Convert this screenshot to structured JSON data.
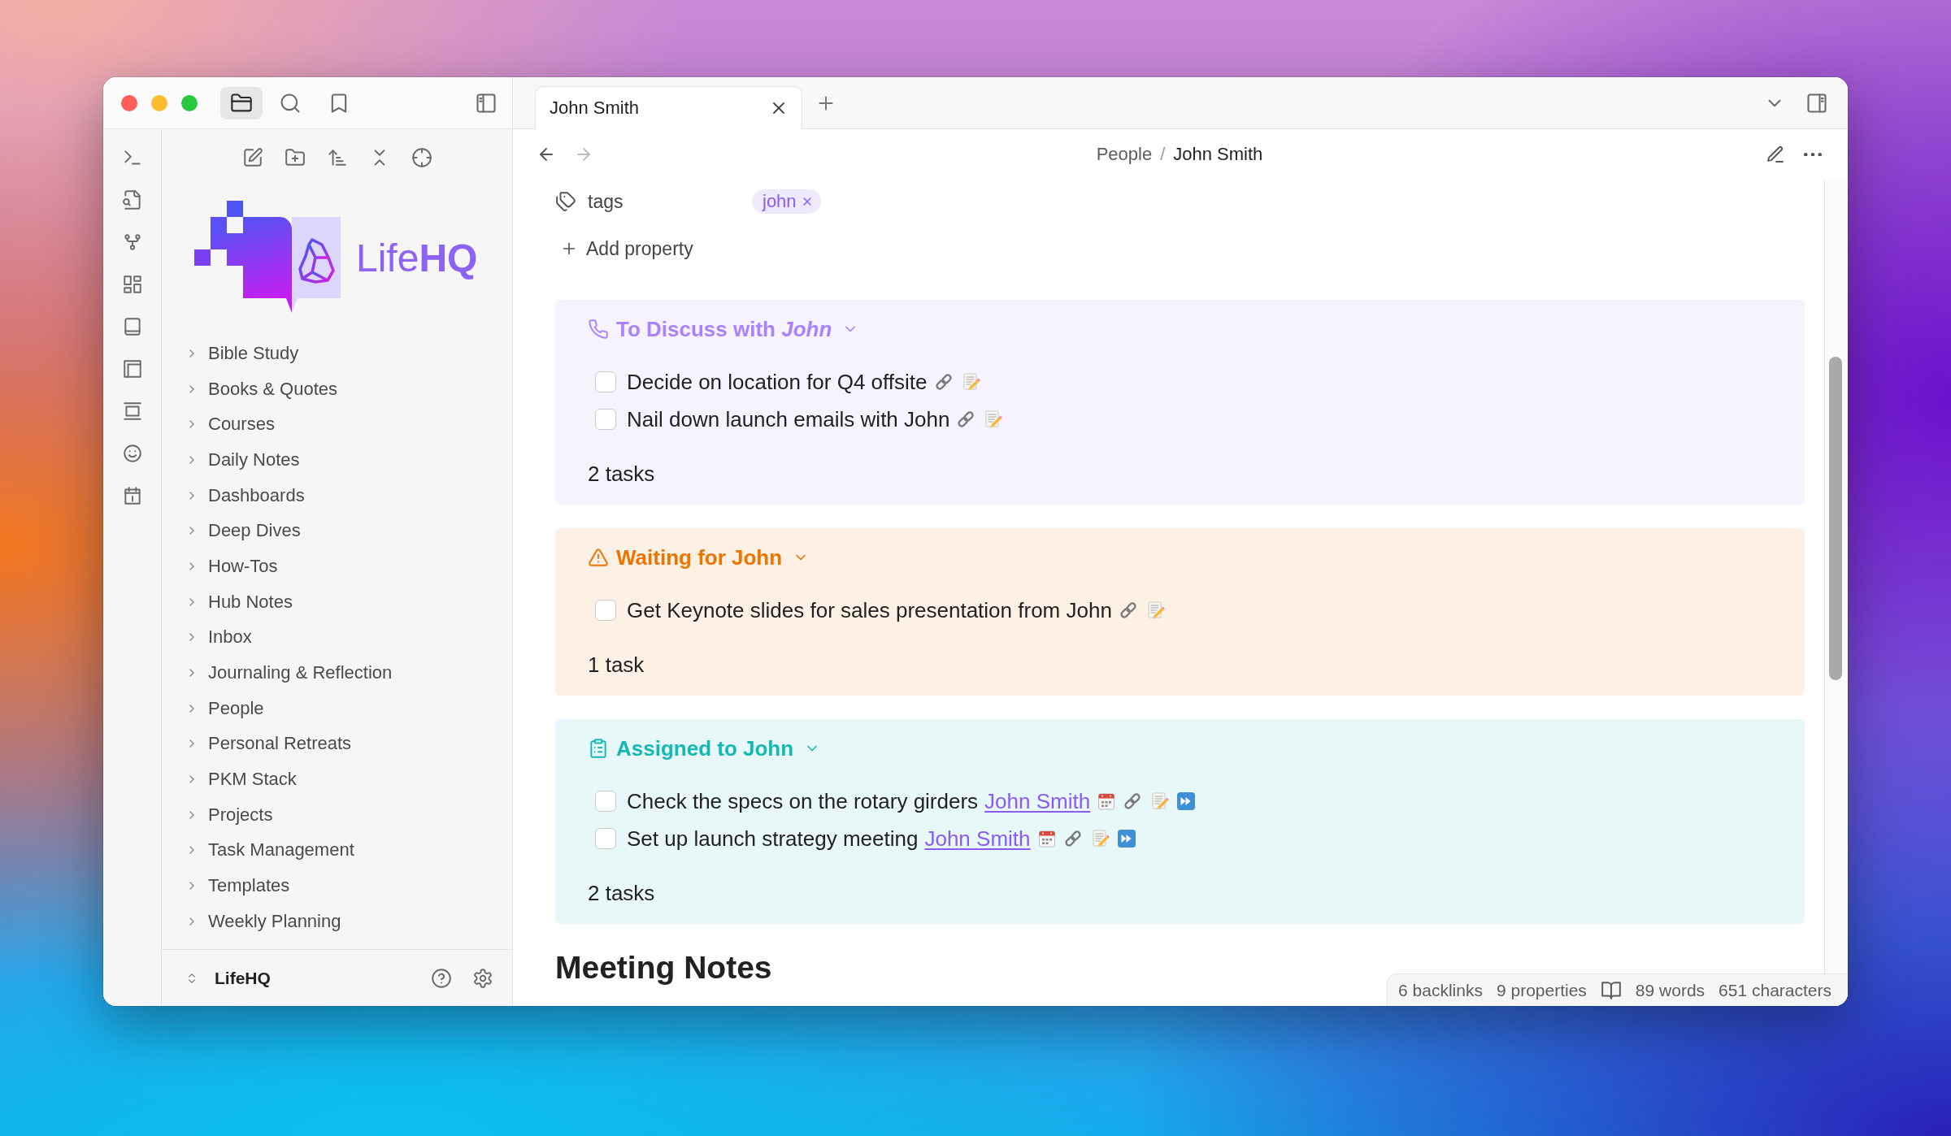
{
  "sidebar_tabs": [
    {
      "kind": "files",
      "selected": true
    },
    {
      "kind": "search",
      "selected": false
    },
    {
      "kind": "bookmarks",
      "selected": false
    }
  ],
  "logo": {
    "text": "Life**HQ**"
  },
  "folders": [
    {
      "name": "Bible Study",
      "expanded": false
    },
    {
      "name": "Books & Quotes",
      "expanded": false
    },
    {
      "name": "Courses",
      "expanded": false
    },
    {
      "name": "Daily Notes",
      "expanded": false
    },
    {
      "name": "Dashboards",
      "expanded": false
    },
    {
      "name": "Deep Dives",
      "expanded": false
    },
    {
      "name": "How-Tos",
      "expanded": false
    },
    {
      "name": "Hub Notes",
      "expanded": false
    },
    {
      "name": "Inbox",
      "expanded": false
    },
    {
      "name": "Journaling & Reflection",
      "expanded": false
    },
    {
      "name": "People",
      "expanded": false
    },
    {
      "name": "Personal Retreats",
      "expanded": false
    },
    {
      "name": "PKM Stack",
      "expanded": false
    },
    {
      "name": "Projects",
      "expanded": false
    },
    {
      "name": "Task Management",
      "expanded": false
    },
    {
      "name": "Templates",
      "expanded": false
    },
    {
      "name": "Weekly Planning",
      "expanded": false
    }
  ],
  "vault": {
    "name": "LifeHQ"
  },
  "tabs": [
    {
      "label": "John Smith",
      "selected": true
    }
  ],
  "navigation": [
    {
      "kind": "back",
      "disabled": false
    },
    {
      "kind": "forward",
      "disabled": true
    }
  ],
  "breadcrumb": {
    "parts": [
      "People",
      "John Smith"
    ],
    "separator": "/"
  },
  "properties": [
    {
      "name": "tags",
      "values": [
        "john"
      ]
    }
  ],
  "add_property": "Add property",
  "callouts": [
    {
      "kind": "discuss",
      "title": "To Discuss with *John*",
      "color": "#a882ff",
      "expanded": true,
      "tasks": [
        {
          "kind": "reference",
          "text": "Decide on location for Q4 offsite",
          "checked": false
        },
        {
          "kind": "reference",
          "text": "Nail down launch emails with John",
          "checked": false
        }
      ],
      "count": "2 tasks"
    },
    {
      "kind": "waiting",
      "title": "Waiting for John",
      "color": "#ec7500",
      "expanded": true,
      "tasks": [
        {
          "kind": "reference",
          "text": "Get Keynote slides for sales presentation from John",
          "checked": false
        }
      ],
      "count": "1 task"
    },
    {
      "kind": "assigned",
      "title": "Assigned to John",
      "color": "#14b8b4",
      "expanded": true,
      "tasks": [
        {
          "kind": "assigned",
          "text": "Check the specs on the rotary girders",
          "mention": "John Smith",
          "checked": false
        },
        {
          "kind": "assigned",
          "text": "Set up launch strategy meeting",
          "mention": "John Smith",
          "checked": false
        }
      ],
      "count": "2 tasks"
    }
  ],
  "heading": "Meeting Notes",
  "status_bar": {
    "links": [
      "6 backlinks",
      "9 properties"
    ],
    "counts": [
      "89 words",
      "651 characters"
    ]
  }
}
